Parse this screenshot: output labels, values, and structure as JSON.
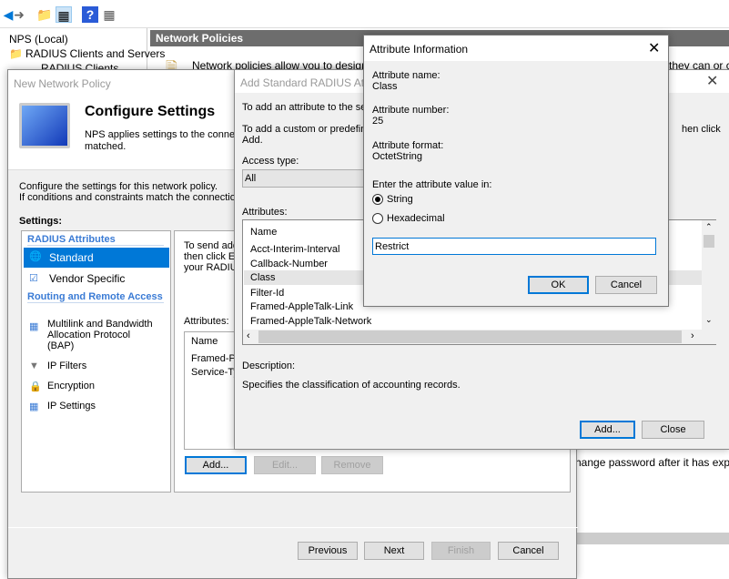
{
  "mmc": {
    "tree": [
      "NPS (Local)",
      "RADIUS Clients and Servers",
      "RADIUS Clients"
    ],
    "header": "Network Policies",
    "info_left": "Network policies allow you to designate wh",
    "info_right": "they can or ca",
    "behind_text": "hange password after it has expired)"
  },
  "wizard": {
    "title": "New Network Policy",
    "heading": "Configure Settings",
    "desc1": "NPS applies settings to the connecti",
    "desc2": "matched.",
    "line1": "Configure the settings for this network policy.",
    "line2": "If conditions and constraints match the connection req",
    "settings_label": "Settings:",
    "sections": [
      {
        "label": "RADIUS Attributes"
      },
      {
        "label": "Routing and Remote Access"
      }
    ],
    "items": [
      {
        "label": "Standard"
      },
      {
        "label": "Vendor Specific"
      },
      {
        "label": "Multilink and Bandwidth Allocation Protocol (BAP)"
      },
      {
        "label": "IP Filters"
      },
      {
        "label": "Encryption"
      },
      {
        "label": "IP Settings"
      }
    ],
    "panel_text1": "To send add",
    "panel_text2": "then click Ed",
    "panel_text3": "your RADIUS",
    "attributes_label": "Attributes:",
    "col_name": "Name",
    "rows": [
      "Framed-Pro",
      "Service-Typ"
    ],
    "add": "Add...",
    "edit": "Edit...",
    "remove": "Remove",
    "previous": "Previous",
    "next": "Next",
    "finish": "Finish",
    "cancel": "Cancel"
  },
  "addstd": {
    "title": "Add Standard RADIUS Attrib",
    "text1": "To add an attribute to the settin",
    "text2a": "To add a custom or predefined",
    "text2b": "Add.",
    "text2c": "hen click",
    "access_label": "Access type:",
    "access_value": "All",
    "attributes_label": "Attributes:",
    "col_name": "Name",
    "rows": [
      "Acct-Interim-Interval",
      "Callback-Number",
      "Class",
      "Filter-Id",
      "Framed-AppleTalk-Link",
      "Framed-AppleTalk-Network"
    ],
    "selected": "Class",
    "desc_label": "Description:",
    "desc": "Specifies the classification of accounting records.",
    "add": "Add...",
    "close": "Close"
  },
  "attrinfo": {
    "title": "Attribute Information",
    "name_label": "Attribute name:",
    "name": "Class",
    "number_label": "Attribute number:",
    "number": "25",
    "format_label": "Attribute format:",
    "format": "OctetString",
    "enter_label": "Enter the attribute value in:",
    "opt_string": "String",
    "opt_hex": "Hexadecimal",
    "selected": "String",
    "value": "Restrict",
    "ok": "OK",
    "cancel": "Cancel"
  },
  "colors": {
    "accent": "#0078d7",
    "header": "#6d6d6d",
    "section": "#3a7bd5"
  }
}
